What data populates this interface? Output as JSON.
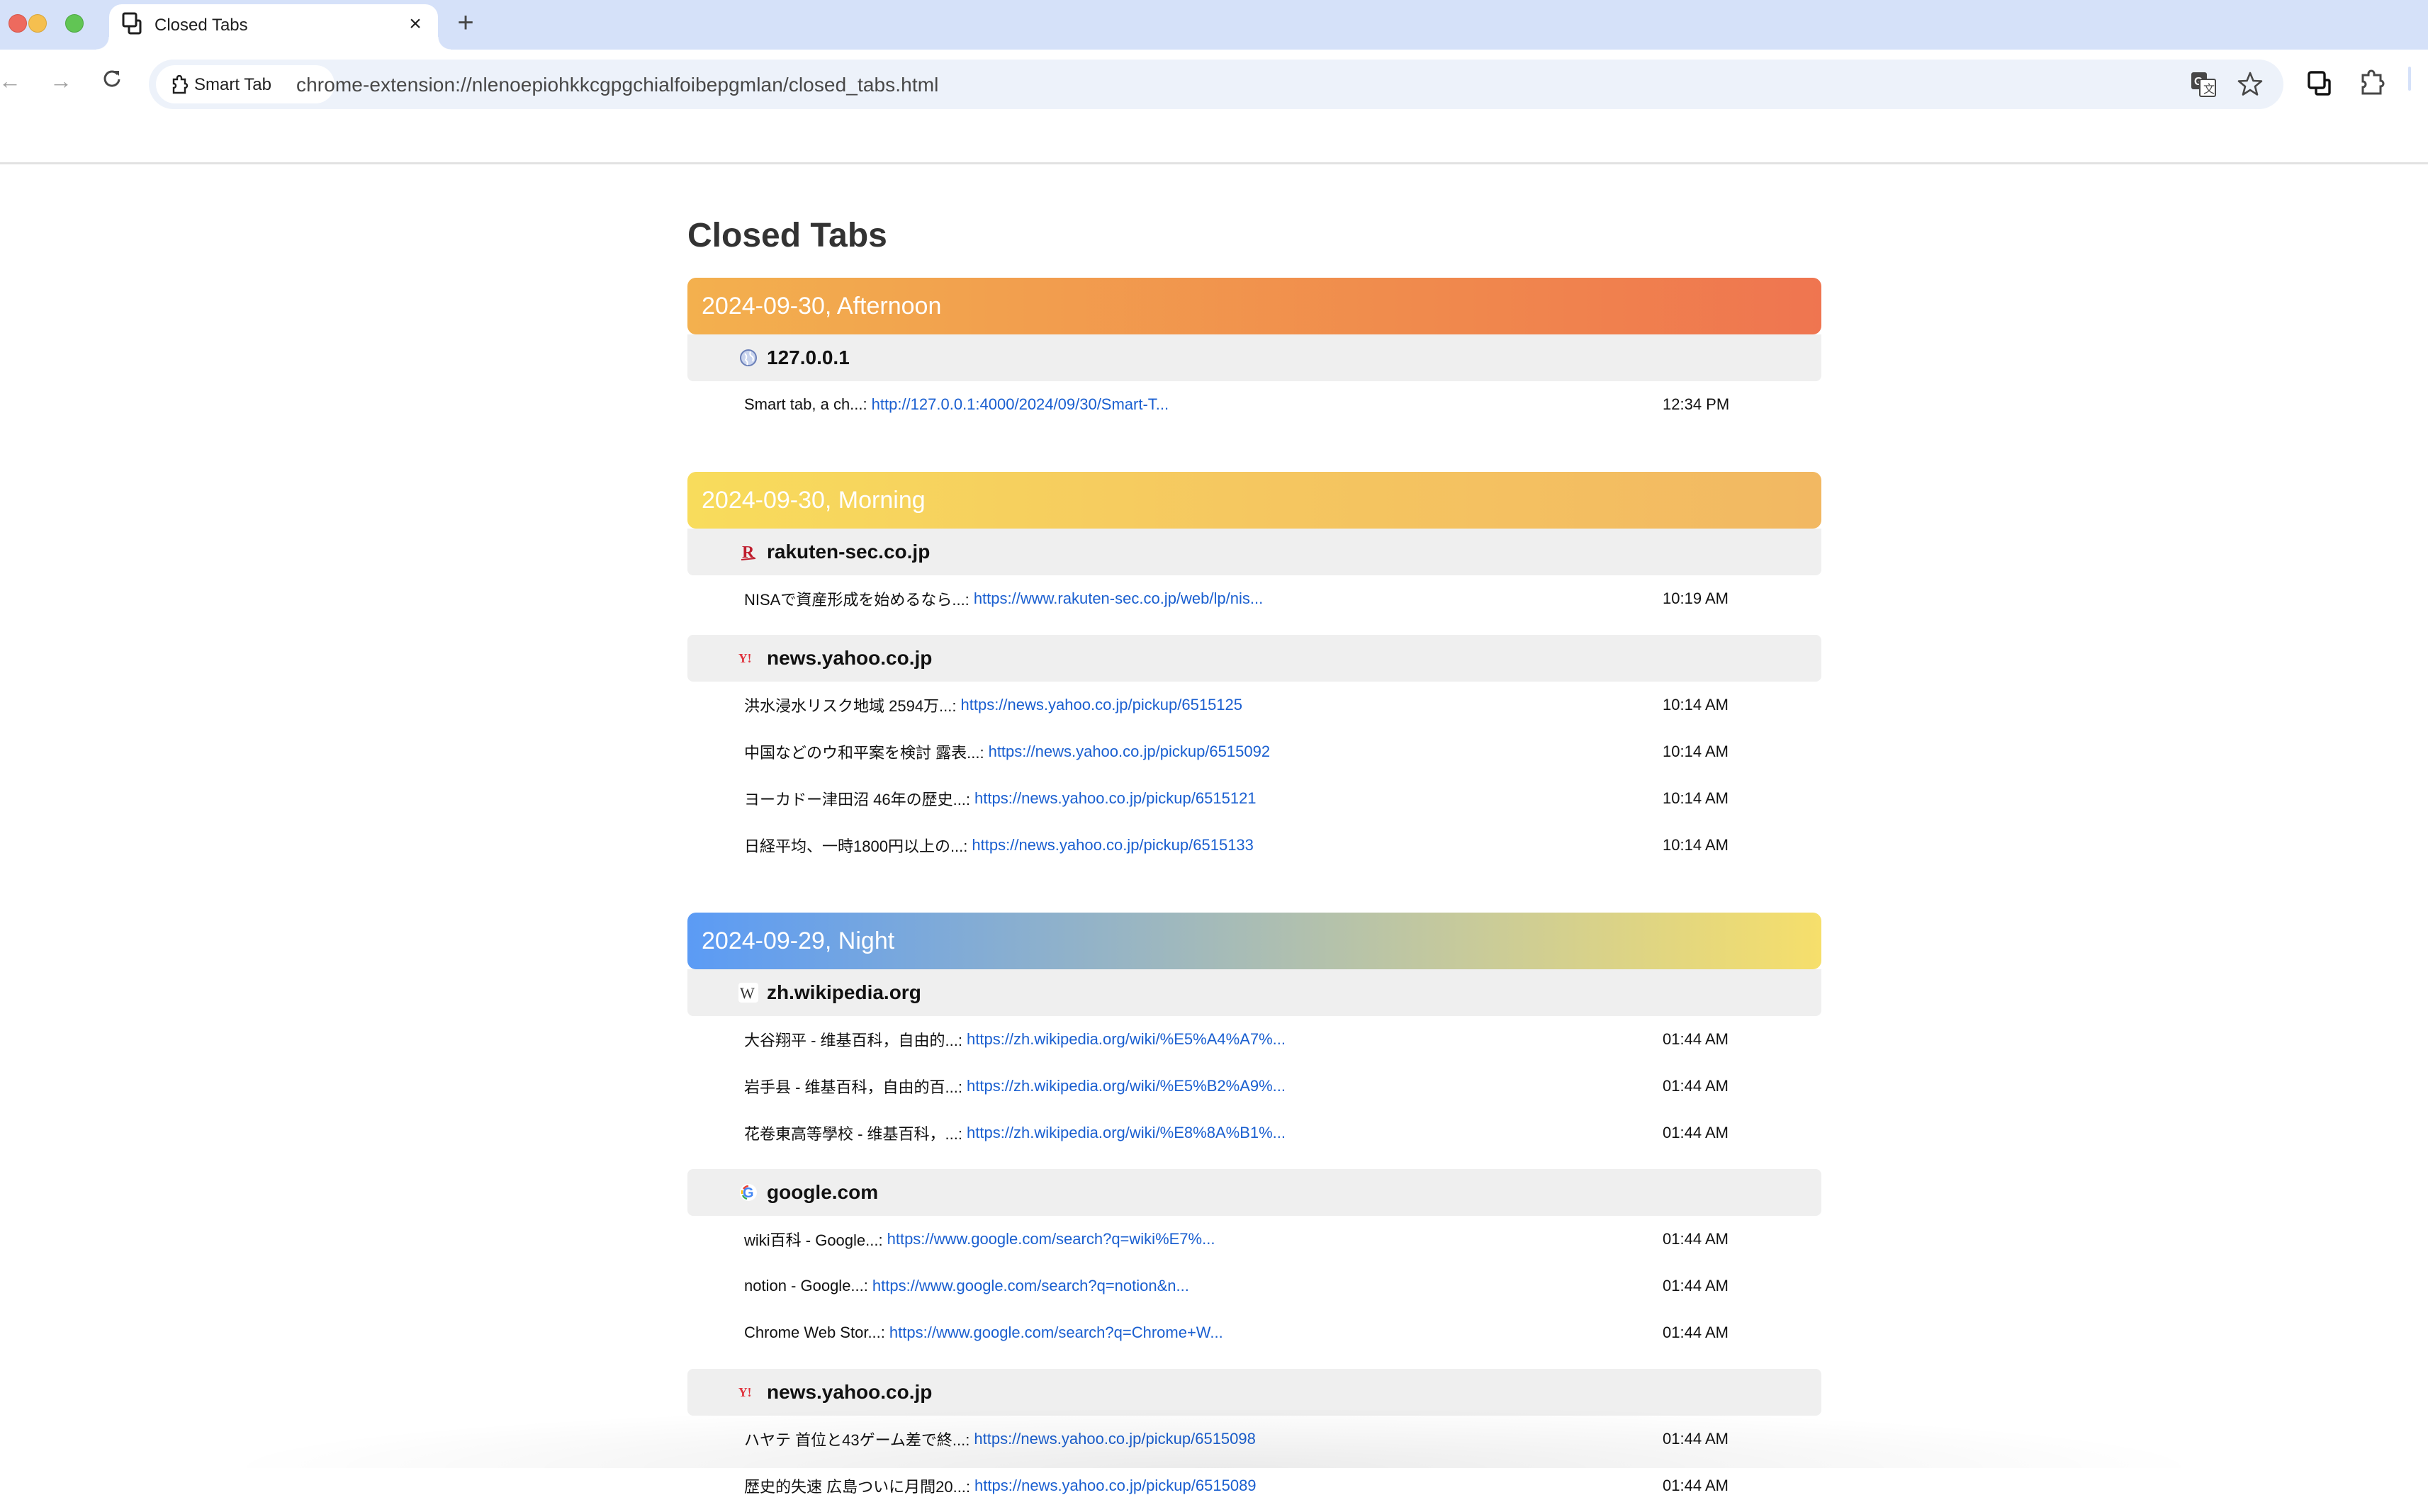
{
  "browser": {
    "tab": {
      "title": "Closed Tabs",
      "icon": "tab-stack-icon",
      "close_label": "×"
    },
    "new_tab_label": "+",
    "nav": {
      "back": "←",
      "forward": "→",
      "reload": "↻"
    },
    "omnibox": {
      "site_chip_label": "Smart Tab",
      "url": "chrome-extension://nlenoepiohkkcgpgchialfoibepgmlan/closed_tabs.html"
    },
    "toolbar_icons": [
      "translate-icon",
      "bookmark-star-icon",
      "tab-search-icon",
      "extensions-icon"
    ]
  },
  "page": {
    "title": "Closed Tabs",
    "periods": [
      {
        "label": "2024-09-30, Afternoon",
        "theme": "afternoon",
        "colors": [
          "#f3b04e",
          "#ef7550"
        ],
        "groups": [
          {
            "domain": "127.0.0.1",
            "favicon": "globe-icon",
            "items": [
              {
                "title": "Smart tab, a ch...:",
                "url": "http://127.0.0.1:4000/2024/09/30/Smart-T...",
                "time": "12:34 PM"
              }
            ]
          }
        ]
      },
      {
        "label": "2024-09-30, Morning",
        "theme": "morning",
        "colors": [
          "#f8dc5c",
          "#f2b862"
        ],
        "groups": [
          {
            "domain": "rakuten-sec.co.jp",
            "favicon": "rakuten-icon",
            "items": [
              {
                "title": "NISAで資産形成を始めるなら...:",
                "url": "https://www.rakuten-sec.co.jp/web/lp/nis...",
                "time": "10:19 AM"
              }
            ]
          },
          {
            "domain": "news.yahoo.co.jp",
            "favicon": "yahoo-icon",
            "items": [
              {
                "title": "洪水浸水リスク地域 2594万...:",
                "url": "https://news.yahoo.co.jp/pickup/6515125",
                "time": "10:14 AM"
              },
              {
                "title": "中国などのウ和平案を検討 露表...:",
                "url": "https://news.yahoo.co.jp/pickup/6515092",
                "time": "10:14 AM"
              },
              {
                "title": "ヨーカドー津田沼 46年の歴史...:",
                "url": "https://news.yahoo.co.jp/pickup/6515121",
                "time": "10:14 AM"
              },
              {
                "title": "日経平均、一時1800円以上の...:",
                "url": "https://news.yahoo.co.jp/pickup/6515133",
                "time": "10:14 AM"
              }
            ]
          }
        ]
      },
      {
        "label": "2024-09-29, Night",
        "theme": "night",
        "colors": [
          "#5b9bf5",
          "#f6df6b"
        ],
        "groups": [
          {
            "domain": "zh.wikipedia.org",
            "favicon": "wikipedia-icon",
            "items": [
              {
                "title": "大谷翔平 - 维基百科，自由的...:",
                "url": "https://zh.wikipedia.org/wiki/%E5%A4%A7%...",
                "time": "01:44 AM"
              },
              {
                "title": "岩手县 - 维基百科，自由的百...:",
                "url": "https://zh.wikipedia.org/wiki/%E5%B2%A9%...",
                "time": "01:44 AM"
              },
              {
                "title": "花卷東高等學校 - 维基百科，...:",
                "url": "https://zh.wikipedia.org/wiki/%E8%8A%B1%...",
                "time": "01:44 AM"
              }
            ]
          },
          {
            "domain": "google.com",
            "favicon": "google-icon",
            "items": [
              {
                "title": "wiki百科 - Google...:",
                "url": "https://www.google.com/search?q=wiki%E7%...",
                "time": "01:44 AM"
              },
              {
                "title": "notion - Google...:",
                "url": "https://www.google.com/search?q=notion&n...",
                "time": "01:44 AM"
              },
              {
                "title": "Chrome Web Stor...:",
                "url": "https://www.google.com/search?q=Chrome+W...",
                "time": "01:44 AM"
              }
            ]
          },
          {
            "domain": "news.yahoo.co.jp",
            "favicon": "yahoo-icon",
            "items": [
              {
                "title": "ハヤテ 首位と43ゲーム差で終...:",
                "url": "https://news.yahoo.co.jp/pickup/6515098",
                "time": "01:44 AM"
              },
              {
                "title": "歴史的失速 広島ついに月間20...:",
                "url": "https://news.yahoo.co.jp/pickup/6515089",
                "time": "01:44 AM"
              }
            ]
          }
        ]
      }
    ]
  }
}
